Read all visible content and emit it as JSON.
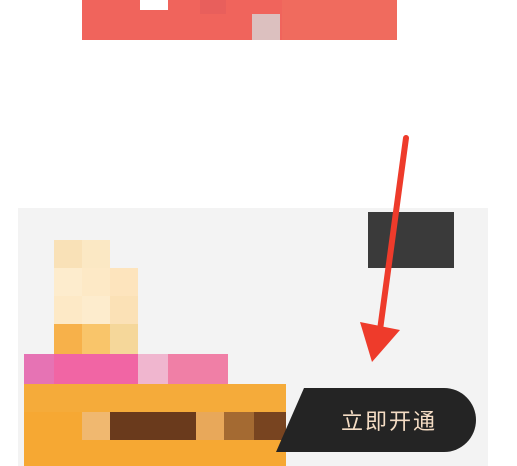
{
  "cta": {
    "label": "立即开通"
  },
  "icons": {
    "annotation_arrow": "red-arrow-icon"
  },
  "colors": {
    "banner_red": "#f0645c",
    "cta_background": "#242424",
    "cta_text": "#f4dcc4",
    "arrow_red": "#ee3b2b",
    "dark_block": "#3a3a3a"
  }
}
